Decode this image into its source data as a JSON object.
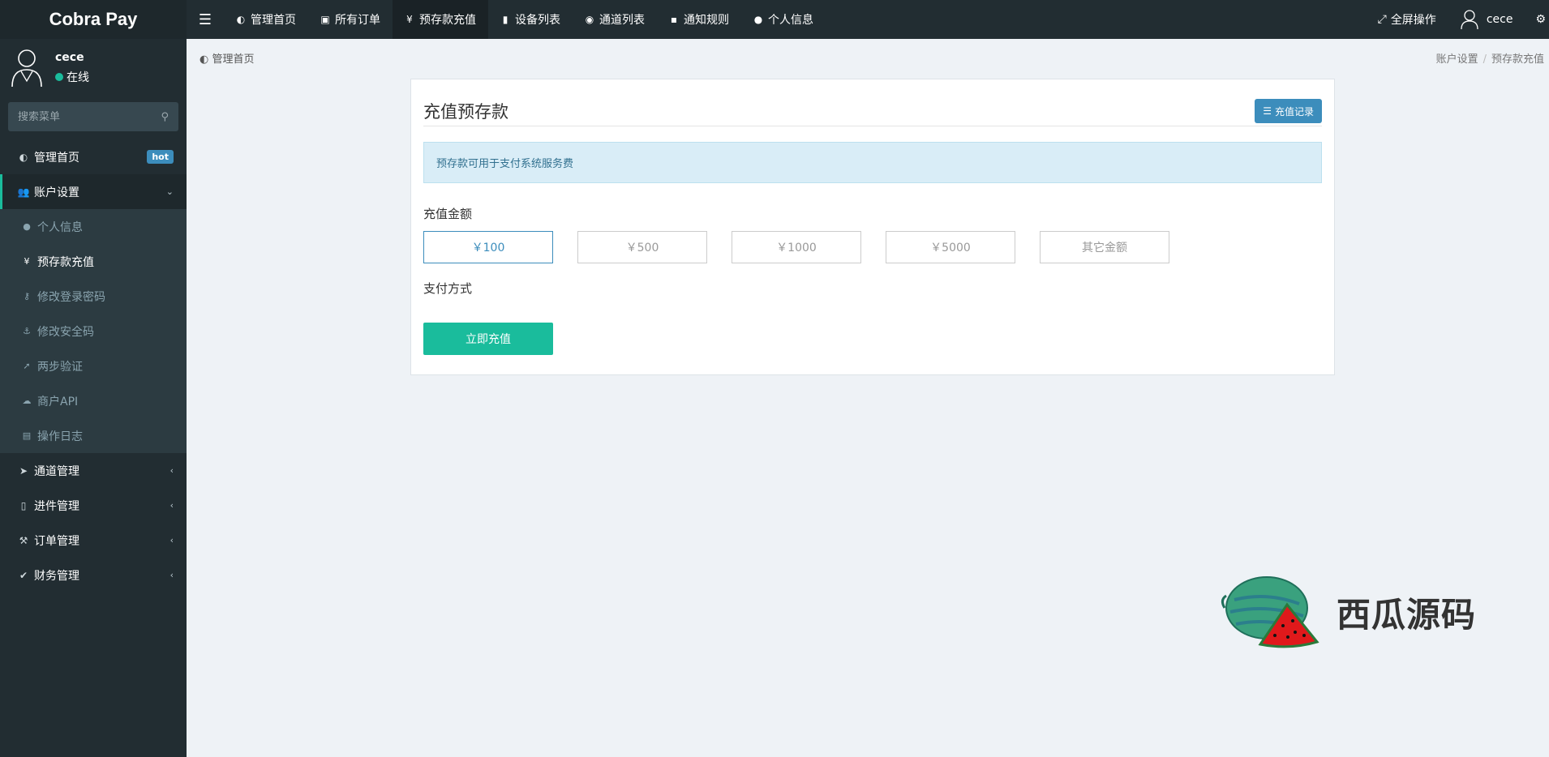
{
  "brand": "Cobra Pay",
  "topnav": {
    "items": [
      {
        "icon": "dashboard-icon",
        "label": "管理首页"
      },
      {
        "icon": "orders-icon",
        "label": "所有订单"
      },
      {
        "icon": "yen-icon",
        "label": "预存款充值"
      },
      {
        "icon": "device-icon",
        "label": "设备列表"
      },
      {
        "icon": "channel-icon",
        "label": "通道列表"
      },
      {
        "icon": "rules-icon",
        "label": "通知规则"
      },
      {
        "icon": "user-circle-icon",
        "label": "个人信息"
      }
    ],
    "fullscreen_label": "全屏操作",
    "username": "cece"
  },
  "sidebar": {
    "user": {
      "name": "cece",
      "status": "在线"
    },
    "search_placeholder": "搜索菜单",
    "home": {
      "label": "管理首页",
      "badge": "hot"
    },
    "account": {
      "label": "账户设置",
      "subitems": [
        {
          "label": "个人信息"
        },
        {
          "label": "预存款充值"
        },
        {
          "label": "修改登录密码"
        },
        {
          "label": "修改安全码"
        },
        {
          "label": "两步验证"
        },
        {
          "label": "商户API"
        },
        {
          "label": "操作日志"
        }
      ]
    },
    "groups": [
      {
        "label": "通道管理"
      },
      {
        "label": "进件管理"
      },
      {
        "label": "订单管理"
      },
      {
        "label": "财务管理"
      }
    ]
  },
  "breadcrumb": {
    "home": "管理首页",
    "trail": [
      "账户设置",
      "预存款充值"
    ]
  },
  "page": {
    "title": "充值预存款",
    "record_button": "充值记录",
    "notice": "预存款可用于支付系统服务费",
    "amount_label": "充值金额",
    "amounts": [
      "￥100",
      "￥500",
      "￥1000",
      "￥5000",
      "其它金额"
    ],
    "selected_amount": "￥100",
    "pay_method_label": "支付方式",
    "submit_button": "立即充值"
  },
  "watermark": "西瓜源码",
  "colors": {
    "accent": "#1abc9c",
    "primary": "#3c8dbc",
    "sidebar": "#222d32"
  }
}
